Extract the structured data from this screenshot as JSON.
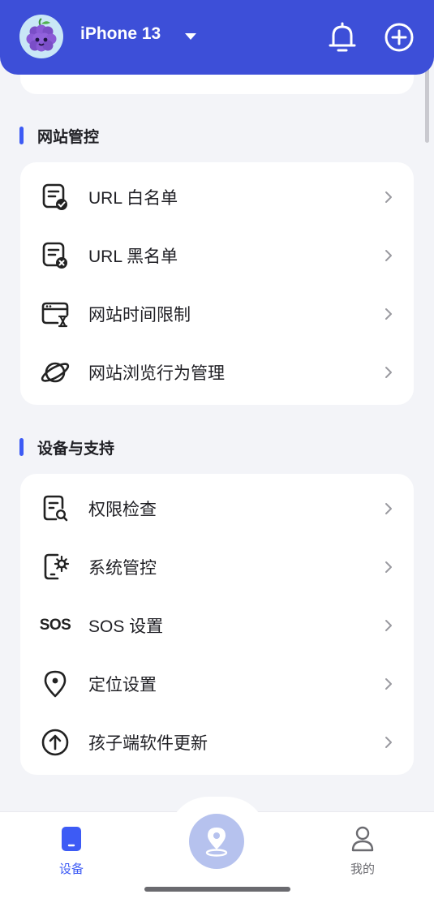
{
  "header": {
    "device_name": "iPhone 13",
    "colors": {
      "background": "#3d4fd8",
      "avatar_bg": "#c9e7f6"
    },
    "icons": {
      "avatar": "grape-avatar-icon",
      "caret": "caret-down-icon",
      "bell": "bell-icon",
      "add": "plus-circle-icon"
    }
  },
  "sections": [
    {
      "title": "网站管控",
      "items": [
        {
          "label": "URL 白名单",
          "icon": "document-check-icon"
        },
        {
          "label": "URL 黑名单",
          "icon": "document-x-icon"
        },
        {
          "label": "网站时间限制",
          "icon": "browser-hourglass-icon"
        },
        {
          "label": "网站浏览行为管理",
          "icon": "planet-icon"
        }
      ]
    },
    {
      "title": "设备与支持",
      "items": [
        {
          "label": "权限检查",
          "icon": "document-search-icon"
        },
        {
          "label": "系统管控",
          "icon": "tablet-gear-icon"
        },
        {
          "label": "SOS 设置",
          "icon": "sos-icon",
          "icon_text": "SOS"
        },
        {
          "label": "定位设置",
          "icon": "location-pin-icon"
        },
        {
          "label": "孩子端软件更新",
          "icon": "arrow-up-circle-icon"
        }
      ]
    }
  ],
  "tabbar": {
    "tabs": [
      {
        "label": "设备",
        "icon": "device-icon",
        "active": true
      },
      {
        "label": "我的",
        "icon": "user-icon",
        "active": false
      }
    ],
    "center_icon": "location-pin-icon",
    "colors": {
      "active": "#3d5bf5",
      "inactive": "#6b6b70",
      "center_bg": "#b6c2ee"
    }
  }
}
